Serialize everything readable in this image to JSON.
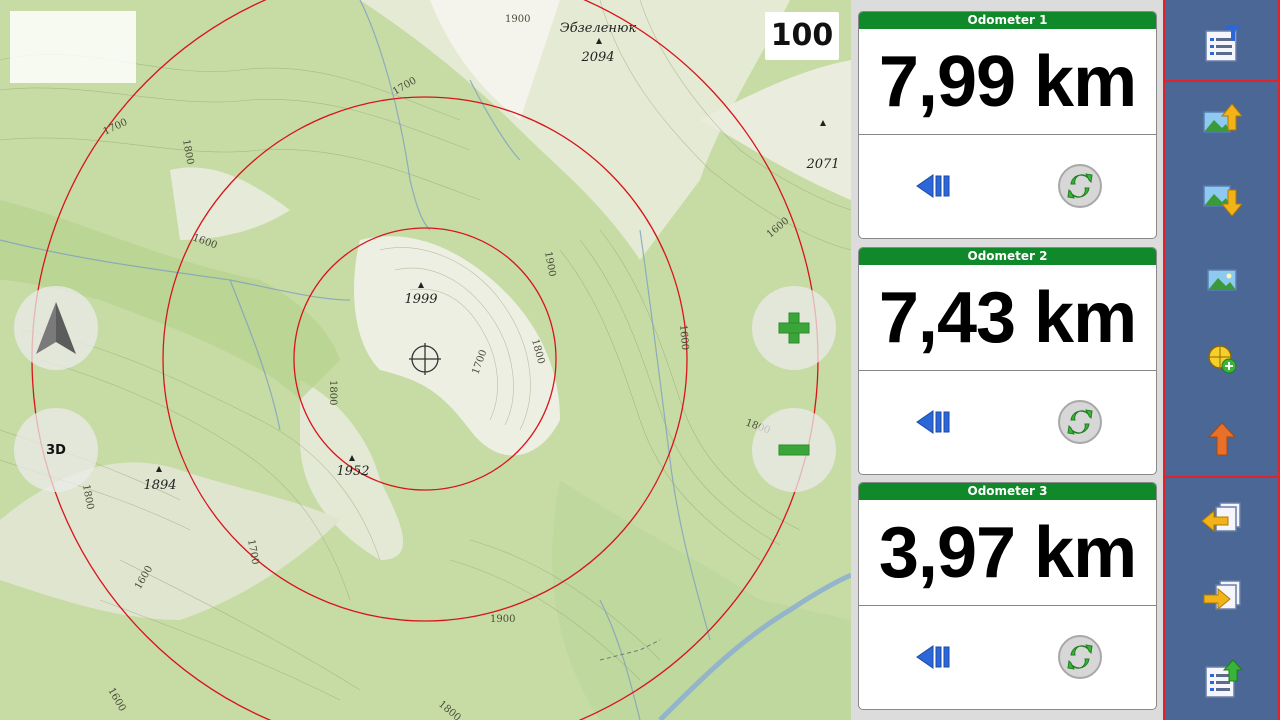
{
  "map": {
    "scale_value": "100",
    "three_d_label": "3D",
    "peaks": [
      {
        "name": "Эбзеленюк",
        "elevation": "2094"
      },
      {
        "elevation": "2071"
      },
      {
        "elevation": "1999"
      },
      {
        "elevation": "1952"
      },
      {
        "elevation": "1894"
      }
    ],
    "contour_labels": [
      "1900",
      "1700",
      "1700",
      "1800",
      "1600",
      "1900",
      "1800",
      "1700",
      "1600",
      "1600",
      "1800",
      "1800",
      "1700",
      "1600",
      "1900",
      "1800",
      "1600",
      "1800",
      "1700",
      "1500",
      "1500",
      "1600"
    ],
    "icons": {
      "north": "north-arrow-icon",
      "zoom_in": "plus-icon",
      "zoom_out": "minus-icon",
      "crosshair": "crosshair-icon"
    },
    "colors": {
      "range_rings": "#d8141b",
      "zoom_green": "#3aa63a",
      "terrain": "#c6dca4"
    }
  },
  "odometers": [
    {
      "title": "Odometer 1",
      "value": "7,99 km"
    },
    {
      "title": "Odometer 2",
      "value": "7,43 km"
    },
    {
      "title": "Odometer 3",
      "value": "3,97 km"
    }
  ],
  "odometer_icons": {
    "pause": "pause-icon",
    "reset": "reset-icon"
  },
  "toolbar": {
    "buttons": [
      "list-edit-icon",
      "image-up-icon",
      "image-down-icon",
      "image-icon",
      "add-waypoint-icon",
      "arrow-up-icon",
      "back-panel-icon",
      "forward-panel-icon",
      "list-export-icon"
    ],
    "colors": {
      "background": "#4a6796",
      "separator": "#e2232a"
    }
  },
  "colors": {
    "odometer_header": "#10892a"
  }
}
